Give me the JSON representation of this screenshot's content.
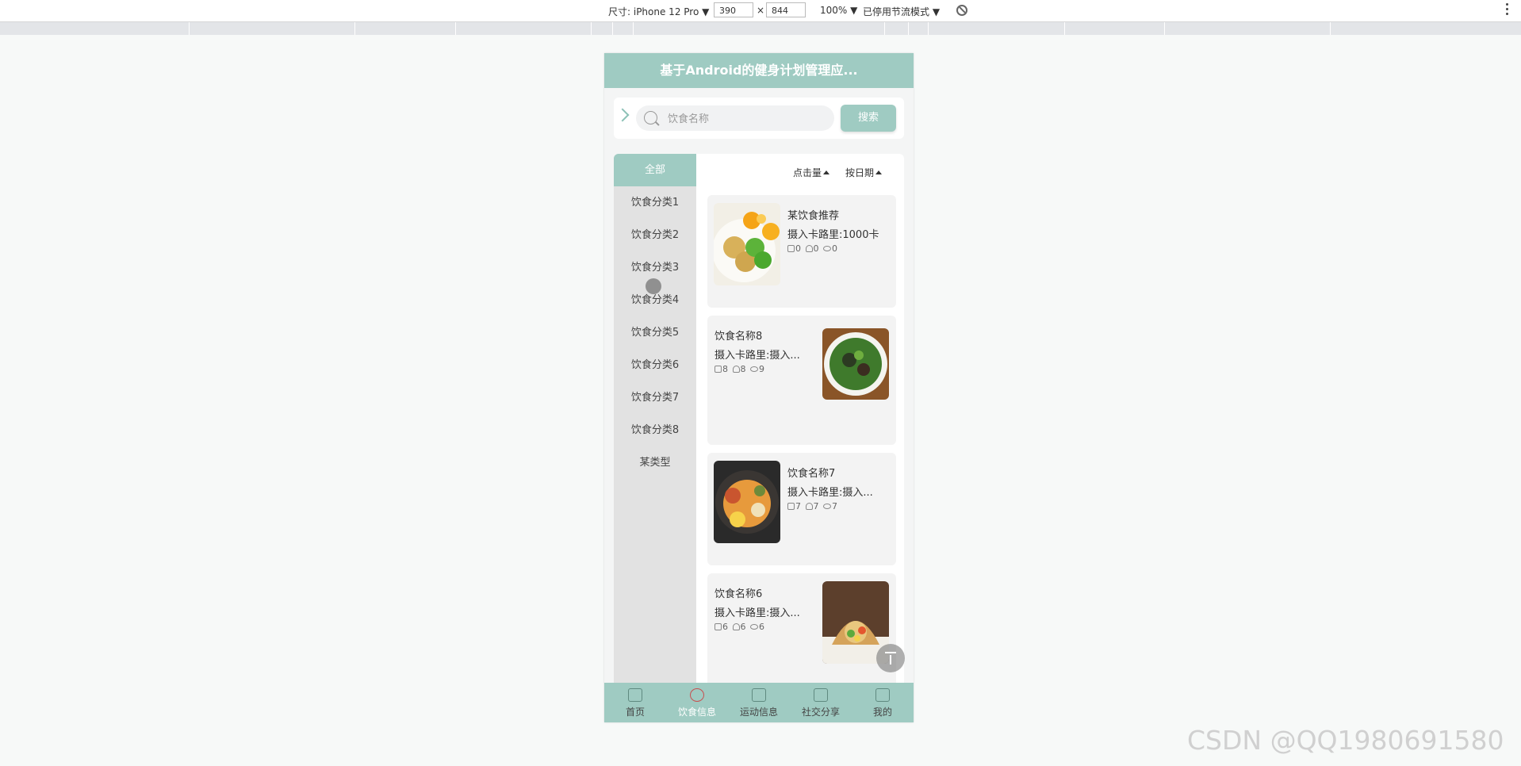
{
  "devtools": {
    "device_label": "尺寸: iPhone 12 Pro ▼",
    "width": "390",
    "times": "×",
    "height": "844",
    "zoom": "100% ▼",
    "throttle": "已停用节流模式 ▼"
  },
  "app": {
    "title": "基于Android的健身计划管理应...",
    "search_placeholder": "饮食名称",
    "search_button": "搜索"
  },
  "categories": [
    "全部",
    "饮食分类1",
    "饮食分类2",
    "饮食分类3",
    "饮食分类4",
    "饮食分类5",
    "饮食分类6",
    "饮食分类7",
    "饮食分类8",
    "某类型"
  ],
  "sort": {
    "clicks": "点击量",
    "date": "按日期"
  },
  "foods": [
    {
      "name": "某饮食推荐",
      "calories": "摄入卡路里:1000卡",
      "likes": "0",
      "stars": "0",
      "views": "0"
    },
    {
      "name": "饮食名称8",
      "calories": "摄入卡路里:摄入...",
      "likes": "8",
      "stars": "8",
      "views": "9"
    },
    {
      "name": "饮食名称7",
      "calories": "摄入卡路里:摄入...",
      "likes": "7",
      "stars": "7",
      "views": "7"
    },
    {
      "name": "饮食名称6",
      "calories": "摄入卡路里:摄入...",
      "likes": "6",
      "stars": "6",
      "views": "6"
    }
  ],
  "tabs": [
    "首页",
    "饮食信息",
    "运动信息",
    "社交分享",
    "我的"
  ],
  "watermark": "CSDN @QQ1980691580",
  "colors": {
    "accent": "#9fcbc2",
    "active_tab_icon": "#c84f4f"
  }
}
